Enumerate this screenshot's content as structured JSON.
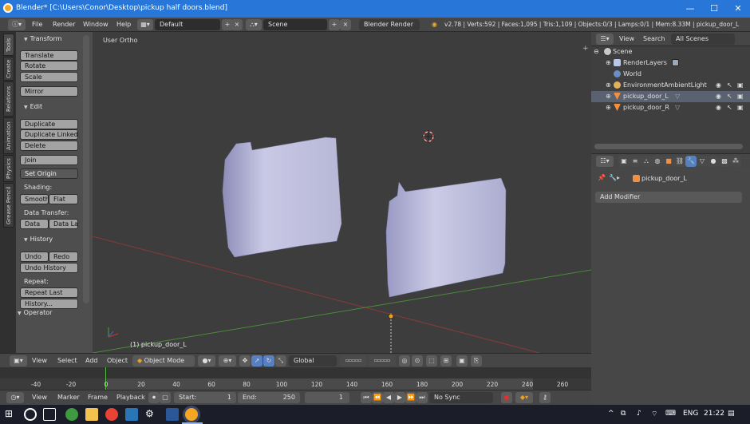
{
  "window": {
    "title": "Blender* [C:\\Users\\Conor\\Desktop\\pickup half doors.blend]",
    "min": "—",
    "max": "☐",
    "close": "✕"
  },
  "info": {
    "menus": [
      "File",
      "Render",
      "Window",
      "Help"
    ],
    "layout": "Default",
    "scene": "Scene",
    "engine": "Blender Render",
    "stats": "v2.78 | Verts:592 | Faces:1,095 | Tris:1,109 | Objects:0/3 | Lamps:0/1 | Mem:8.33M | pickup_door_L"
  },
  "tabs": [
    "Tools",
    "Create",
    "Relations",
    "Animation",
    "Physics",
    "Grease Pencil"
  ],
  "toolshelf": {
    "transform": {
      "title": "Transform",
      "buttons": [
        "Translate",
        "Rotate",
        "Scale",
        "Mirror"
      ]
    },
    "edit": {
      "title": "Edit",
      "buttons": [
        "Duplicate",
        "Duplicate Linked",
        "Delete",
        "Join"
      ],
      "origin": "Set Origin",
      "shading_label": "Shading:",
      "smooth": "Smooth",
      "flat": "Flat",
      "transfer_label": "Data Transfer:",
      "data": "Data",
      "data_la": "Data La"
    },
    "history": {
      "title": "History",
      "undo": "Undo",
      "redo": "Redo",
      "undo_history": "Undo History",
      "repeat_label": "Repeat:",
      "repeat_last": "Repeat Last",
      "history_btn": "History..."
    },
    "operator": "Operator"
  },
  "viewport": {
    "view_label": "User Ortho",
    "object_label": "(1) pickup_door_L"
  },
  "header3d": {
    "menus": [
      "View",
      "Select",
      "Add",
      "Object"
    ],
    "mode": "Object Mode",
    "orientation": "Global"
  },
  "timeline": {
    "ticks": [
      "-40",
      "-20",
      "0",
      "20",
      "40",
      "60",
      "80",
      "100",
      "120",
      "140",
      "160",
      "180",
      "200",
      "220",
      "240",
      "260"
    ],
    "tick_values": [
      -40,
      -20,
      0,
      20,
      40,
      60,
      80,
      100,
      120,
      140,
      160,
      180,
      200,
      220,
      240,
      260
    ],
    "current_frame": 1
  },
  "timeline_header": {
    "menus": [
      "View",
      "Marker",
      "Frame",
      "Playback"
    ],
    "start": "Start:",
    "start_val": "1",
    "end": "End:",
    "end_val": "250",
    "frame": "1",
    "sync": "No Sync"
  },
  "outliner": {
    "menus": [
      "View",
      "Search"
    ],
    "filter": "All Scenes",
    "rows": [
      {
        "name": "Scene",
        "color": "#c9c9c9"
      },
      {
        "name": "RenderLayers",
        "color": "#b8c8e8"
      },
      {
        "name": "World",
        "color": "#6a8fc4"
      },
      {
        "name": "EnvironmentAmbientLight",
        "color": "#e3b05a"
      },
      {
        "name": "pickup_door_L",
        "color": "#f09040"
      },
      {
        "name": "pickup_door_R",
        "color": "#f09040"
      }
    ]
  },
  "properties": {
    "object": "pickup_door_L",
    "add_modifier": "Add Modifier"
  },
  "taskbar": {
    "lang": "ENG",
    "time": "21:22"
  }
}
